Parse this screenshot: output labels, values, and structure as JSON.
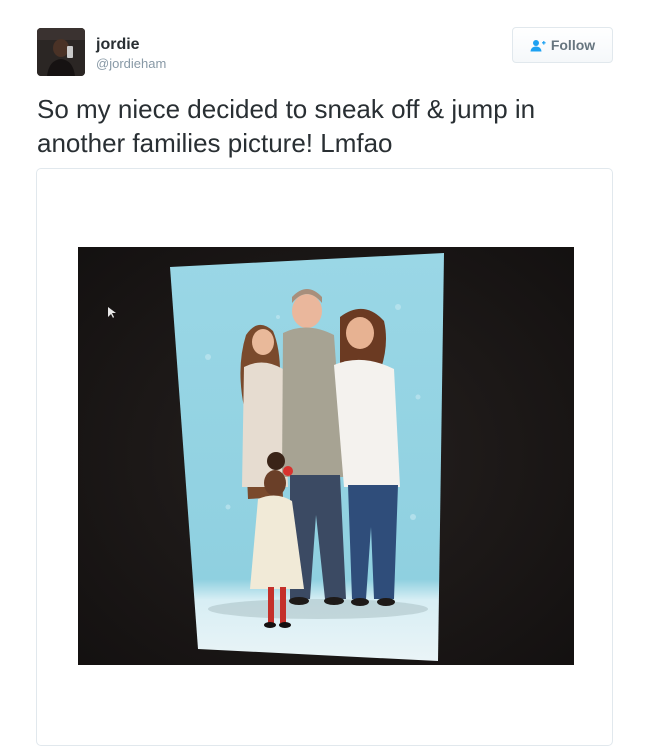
{
  "user": {
    "display_name": "jordie",
    "handle": "@jordieham",
    "avatar_icon": "profile-photo"
  },
  "follow_button": {
    "label": "Follow",
    "icon": "add-user-icon"
  },
  "tweet": {
    "text": "So my niece decided to sneak off & jump in another families picture! Lmfao"
  },
  "media": {
    "type": "photo"
  },
  "colors": {
    "text": "#292f33",
    "muted": "#8899a6",
    "accent": "#1da1f2",
    "border": "#e1e8ed",
    "backdrop": "#8fd2e2"
  }
}
